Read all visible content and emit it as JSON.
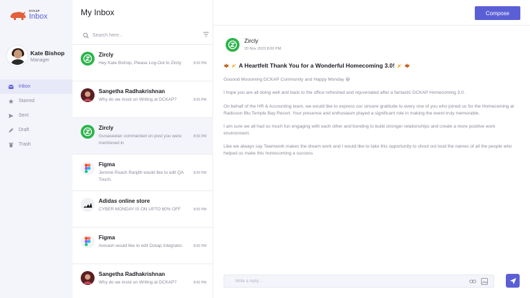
{
  "brand": {
    "small": "DCKAP",
    "name": "Inbox"
  },
  "profile": {
    "name": "Kate Bishop",
    "role": "Manager"
  },
  "nav": [
    {
      "label": "Inbox",
      "icon": "inbox-icon",
      "active": true
    },
    {
      "label": "Starred",
      "icon": "star-icon",
      "active": false
    },
    {
      "label": "Sent",
      "icon": "send-icon",
      "active": false
    },
    {
      "label": "Draft",
      "icon": "pencil-icon",
      "active": false
    },
    {
      "label": "Trash",
      "icon": "trash-icon",
      "active": false
    }
  ],
  "header": {
    "title": "My Inbox",
    "compose_label": "Compose"
  },
  "search": {
    "placeholder": "Search here..."
  },
  "messages": [
    {
      "from": "Zircly",
      "preview": "Hey Kate Bishop, Please Log-Out to Zircly",
      "time": "8:00 PM",
      "icon": "zircly"
    },
    {
      "from": "Sangetha Radhakrishnan",
      "preview": "Why do we insist on Writing at DCKAP?",
      "time": "8:00 PM",
      "icon": "person"
    },
    {
      "from": "Zircly",
      "preview": "Gunaseelan commented on post you were mentioned in",
      "time": "8:00 PM",
      "icon": "zircly"
    },
    {
      "from": "Figma",
      "preview": "Jerome Roach Ranjith would like to edit QA Touch.",
      "time": "8:00 PM",
      "icon": "figma"
    },
    {
      "from": "Adidas online store",
      "preview": "CYBER MONDAY IS ON UPTO 60% OFF",
      "time": "8:00 PM",
      "icon": "adidas"
    },
    {
      "from": "Figma",
      "preview": "Avinash would like to edit Dckap Integrator.",
      "time": "8:00 PM",
      "icon": "figma"
    },
    {
      "from": "Sangetha Radhakrishnan",
      "preview": "Why do we insist on Writing at DCKAP?",
      "time": "8:00 PM",
      "icon": "person"
    }
  ],
  "open_message": {
    "sender": "Zircly",
    "date": "20 Nov 2023 8:00 PM",
    "subject": "A Heartfelt Thank You for a Wonderful Homecoming 3.0!",
    "paragraphs": [
      "Gooood Moooming DCKAP Community and Happy Monday 😀",
      "I hope you are all doing well and back to the office refreshed and rejuvenated after a fantastic DCKAP Homecoming 3.0.",
      "On behalf of the HR & Accounting team, we would like to express our sincere gratitude to every one of you who joined us for the Homecoming at Radisson Blu Temple Bay Resort. Your presence and enthusiasm played a significant role in making the event truly memorable.",
      "I am sure we all had so much fun engaging with each other and bonding to build stronger relationships and create a more positive work environment.",
      "Like we always say Teamwork makes the dream work and I would like to take this opportunity to shout out loud the names of all the people who helped us make this homecoming a success"
    ]
  },
  "reply": {
    "placeholder": "Write a reply..."
  },
  "colors": {
    "accent": "#5b5fd6",
    "zircly": "#2bb34a",
    "sidebar_bg": "#f4f5fb"
  }
}
